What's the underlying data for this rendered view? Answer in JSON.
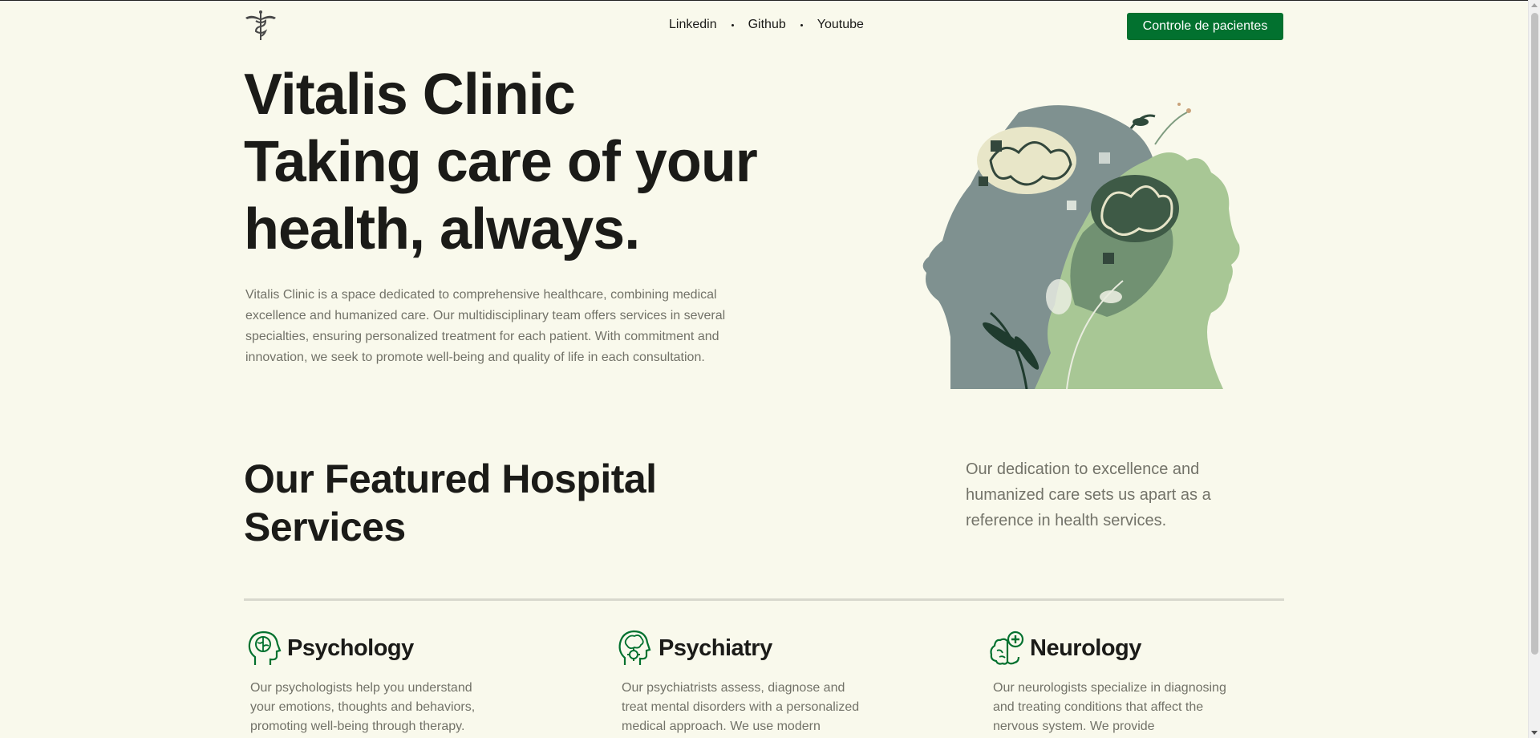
{
  "nav": {
    "links": [
      "Linkedin",
      "Github",
      "Youtube"
    ],
    "cta_label": "Controle de pacientes"
  },
  "hero": {
    "title_lines": [
      "Vitalis Clinic",
      "Taking care of your",
      "health, always."
    ],
    "intro": "Vitalis Clinic is a space dedicated to comprehensive healthcare, combining medical excellence and humanized care. Our multidisciplinary team offers services in several specialties, ensuring personalized treatment for each patient. With commitment and innovation, we seek to promote well-being and quality of life in each consultation."
  },
  "services": {
    "title_lines": [
      "Our Featured Hospital",
      "Services"
    ],
    "tagline": "Our dedication to excellence and humanized care sets us apart as a reference in health services.",
    "items": [
      {
        "icon": "psychology-head-icon",
        "title": "Psychology",
        "description": "Our psychologists help you understand your emotions, thoughts and behaviors, promoting well-being through therapy."
      },
      {
        "icon": "psychiatry-gear-head-icon",
        "title": "Psychiatry",
        "description": "Our psychiatrists assess, diagnose and treat mental disorders with a personalized medical approach. We use modern"
      },
      {
        "icon": "neurology-brain-icon",
        "title": "Neurology",
        "description": "Our neurologists specialize in diagnosing and treating conditions that affect the nervous system. We provide"
      }
    ]
  },
  "colors": {
    "background": "#f9f9ec",
    "accent": "#02712f",
    "text": "#1b1b18",
    "muted_text": "#727268"
  }
}
